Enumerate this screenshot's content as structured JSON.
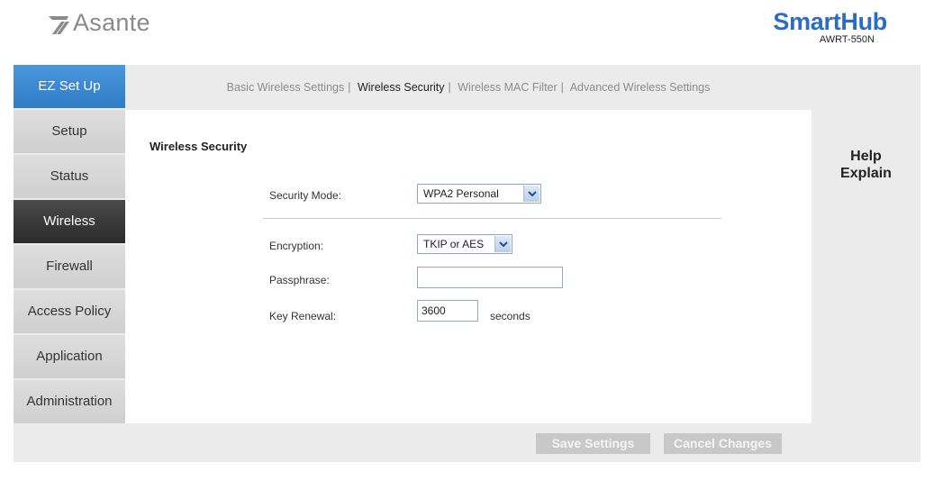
{
  "header": {
    "logo_text": "Asante",
    "brand_title": "SmartHub",
    "brand_model": "AWRT-550N"
  },
  "sidebar": {
    "items": [
      {
        "label": "EZ Set Up"
      },
      {
        "label": "Setup"
      },
      {
        "label": "Status"
      },
      {
        "label": "Wireless"
      },
      {
        "label": "Firewall"
      },
      {
        "label": "Access Policy"
      },
      {
        "label": "Application"
      },
      {
        "label": "Administration"
      }
    ]
  },
  "subnav": {
    "items": [
      {
        "label": "Basic Wireless Settings"
      },
      {
        "label": "Wireless Security"
      },
      {
        "label": "Wireless MAC Filter"
      },
      {
        "label": "Advanced Wireless Settings"
      }
    ],
    "separator": "|"
  },
  "form": {
    "section_title": "Wireless Security",
    "security_mode": {
      "label": "Security Mode:",
      "value": "WPA2 Personal"
    },
    "encryption": {
      "label": "Encryption:",
      "value": "TKIP or AES"
    },
    "passphrase": {
      "label": "Passphrase:",
      "value": ""
    },
    "key_renewal": {
      "label": "Key Renewal:",
      "value": "3600",
      "unit": "seconds"
    }
  },
  "help": {
    "title": "Help",
    "subtitle": "Explain"
  },
  "actions": {
    "save_label": "Save Settings",
    "cancel_label": "Cancel Changes"
  },
  "colors": {
    "accent": "#2f7cc5",
    "brand": "#2b6cc4",
    "active_nav": "#2b2b2b"
  }
}
